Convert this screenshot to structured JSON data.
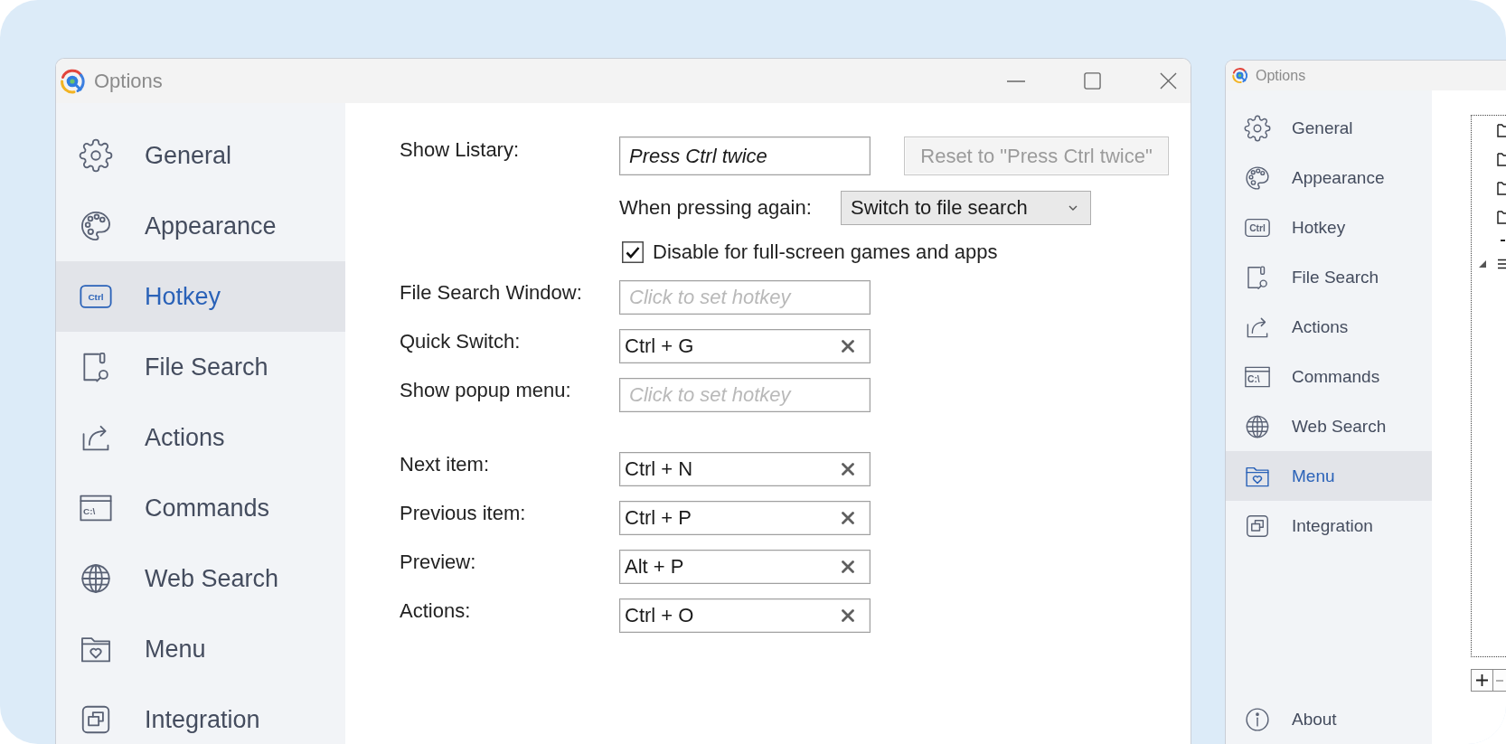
{
  "windows": [
    {
      "title": "Options",
      "sidebar": {
        "items": [
          {
            "label": "General",
            "selected": false
          },
          {
            "label": "Appearance",
            "selected": false
          },
          {
            "label": "Hotkey",
            "icon_text": "Ctrl",
            "selected": true
          },
          {
            "label": "File Search",
            "selected": false
          },
          {
            "label": "Actions",
            "selected": false
          },
          {
            "label": "Commands",
            "icon_text": "C:\\",
            "selected": false
          },
          {
            "label": "Web Search",
            "selected": false
          },
          {
            "label": "Menu",
            "selected": false
          },
          {
            "label": "Integration",
            "selected": false
          }
        ]
      },
      "hotkey_page": {
        "show_listary": {
          "label": "Show Listary:",
          "value": "Press Ctrl twice",
          "reset_button": {
            "label": "Reset to \"Press Ctrl twice\"",
            "disabled": true
          }
        },
        "when_pressing_again": {
          "label": "When pressing again:",
          "value": "Switch to file search"
        },
        "disable_option": {
          "label": "Disable for full-screen games and apps",
          "checked": true
        },
        "hotkeys": [
          {
            "label": "File Search Window:",
            "placeholder": "Click to set hotkey"
          },
          {
            "label": "Quick Switch:",
            "value": "Ctrl + G"
          },
          {
            "label": "Show popup menu:",
            "placeholder": "Click to set hotkey"
          }
        ],
        "navigation_hotkeys": [
          {
            "label": "Next item:",
            "value": "Ctrl + N"
          },
          {
            "label": "Previous item:",
            "value": "Ctrl + P"
          },
          {
            "label": "Preview:",
            "value": "Alt + P"
          },
          {
            "label": "Actions:",
            "value": "Ctrl + O"
          }
        ]
      }
    },
    {
      "title": "Options",
      "sidebar": {
        "items": [
          {
            "label": "General",
            "selected": false
          },
          {
            "label": "Appearance",
            "selected": false
          },
          {
            "label": "Hotkey",
            "icon_text": "Ctrl",
            "selected": false
          },
          {
            "label": "File Search",
            "selected": false
          },
          {
            "label": "Actions",
            "selected": false
          },
          {
            "label": "Commands",
            "icon_text": "C:\\",
            "selected": false
          },
          {
            "label": "Web Search",
            "selected": false
          },
          {
            "label": "Menu",
            "selected": true
          },
          {
            "label": "Integration",
            "selected": false
          }
        ],
        "footer_item": {
          "label": "About",
          "selected": false
        }
      },
      "menu_page": {
        "tree": [
          {
            "kind": "folder"
          },
          {
            "kind": "folder"
          },
          {
            "kind": "folder"
          },
          {
            "kind": "folder"
          },
          {
            "kind": "separator"
          },
          {
            "kind": "group",
            "expanded": true
          }
        ],
        "buttons": [
          {
            "kind": "add",
            "disabled": false
          },
          {
            "kind": "remove",
            "disabled": true
          }
        ]
      }
    }
  ]
}
